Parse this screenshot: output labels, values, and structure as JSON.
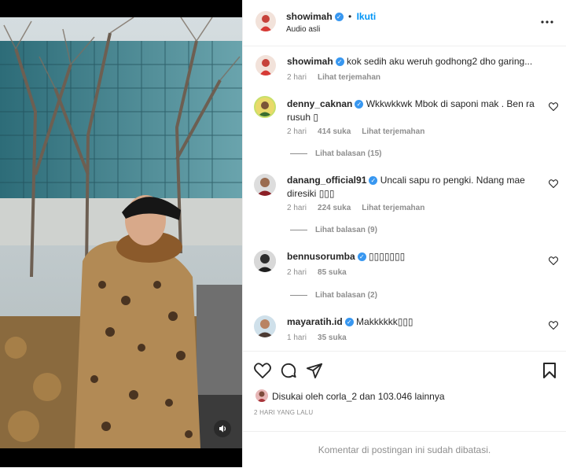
{
  "post": {
    "username": "showimah",
    "verified_mark": "✓",
    "separator": "•",
    "follow_label": "Ikuti",
    "audio_label": "Audio asli",
    "more_icon": "more-horizontal-icon",
    "caption": "kok sedih aku weruh godhong2 dho garing...",
    "caption_time": "2 hari",
    "caption_translate": "Lihat terjemahan"
  },
  "comments": [
    {
      "username": "denny_caknan",
      "text": "Wkkwkkwk Mbok di saponi mak . Ben ra rusuh ",
      "emoji": "▯",
      "time": "2 hari",
      "likes": "414 suka",
      "translate": "Lihat terjemahan",
      "replies": "Lihat balasan (15)"
    },
    {
      "username": "danang_official91",
      "text": "Uncali sapu ro pengki. Ndang mae diresiki ",
      "emoji": "▯▯▯",
      "time": "2 hari",
      "likes": "224 suka",
      "translate": "Lihat terjemahan",
      "replies": "Lihat balasan (9)"
    },
    {
      "username": "bennusorumba",
      "text": "",
      "emoji": "▯▯▯▯▯▯▯",
      "time": "2 hari",
      "likes": "85 suka",
      "translate": "",
      "replies": "Lihat balasan (2)"
    },
    {
      "username": "mayaratih.id",
      "text": "Makkkkkk",
      "emoji": "▯▯▯",
      "time": "1 hari",
      "likes": "35 suka",
      "translate": "",
      "replies": ""
    }
  ],
  "likes": {
    "prefix": "Disukai oleh ",
    "user": "corla_2",
    "middle": " dan ",
    "count": "103.046 lainnya"
  },
  "post_date": "2 HARI YANG LALU",
  "comments_disabled": "Komentar di postingan ini sudah dibatasi.",
  "colors": {
    "accent": "#3897f0",
    "text": "#262626",
    "secondary": "#8e8e8e",
    "border": "#efefef"
  }
}
